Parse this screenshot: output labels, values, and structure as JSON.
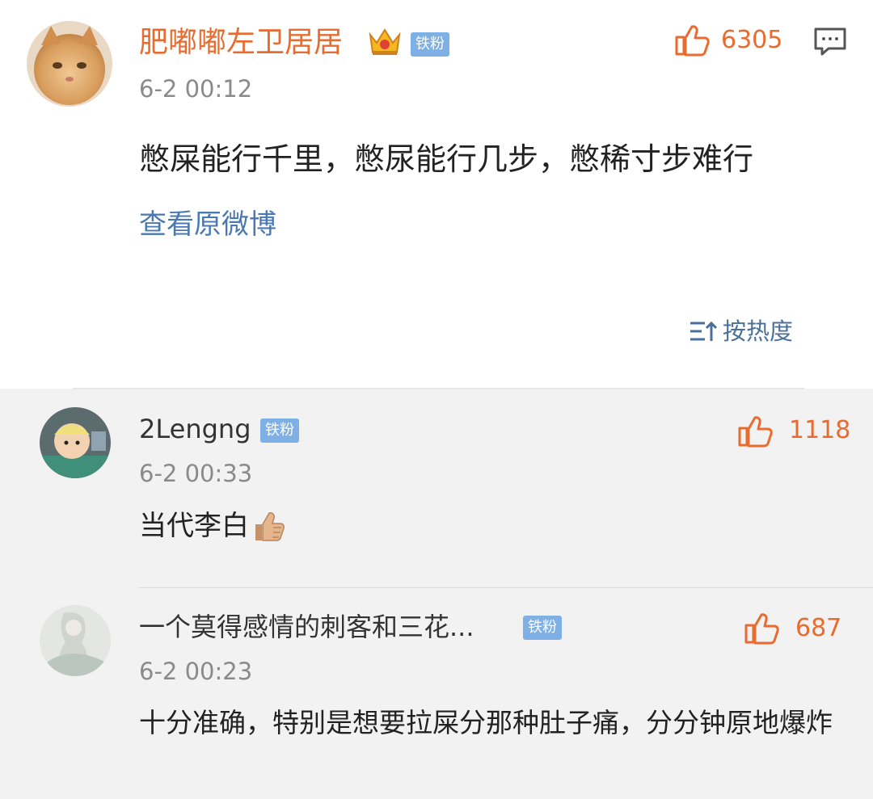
{
  "post": {
    "author": "肥嘟嘟左卫居居",
    "badge": "铁粉",
    "time": "6-2 00:12",
    "likes": "6305",
    "content": "憋屎能行千里，憋尿能行几步，憋稀寸步难行",
    "view_original": "查看原微博"
  },
  "sort": {
    "label": "按热度"
  },
  "replies": [
    {
      "author": "2Lengng",
      "badge": "铁粉",
      "time": "6-2 00:33",
      "likes": "1118",
      "content": "当代李白"
    },
    {
      "author": "一个莫得感情的刺客和三花...",
      "badge": "铁粉",
      "time": "6-2 00:23",
      "likes": "687",
      "content": "十分准确，特别是想要拉屎分那种肚子痛，分分钟原地爆炸"
    }
  ],
  "colors": {
    "accent": "#e86b2f",
    "link": "#4a79b1",
    "badge": "#7eb0e6",
    "reply_bg": "#f2f2f2"
  },
  "icons": [
    "thumbs-up-icon",
    "comment-icon",
    "crown-icon",
    "sort-icon",
    "thumbs-up-emoji"
  ]
}
